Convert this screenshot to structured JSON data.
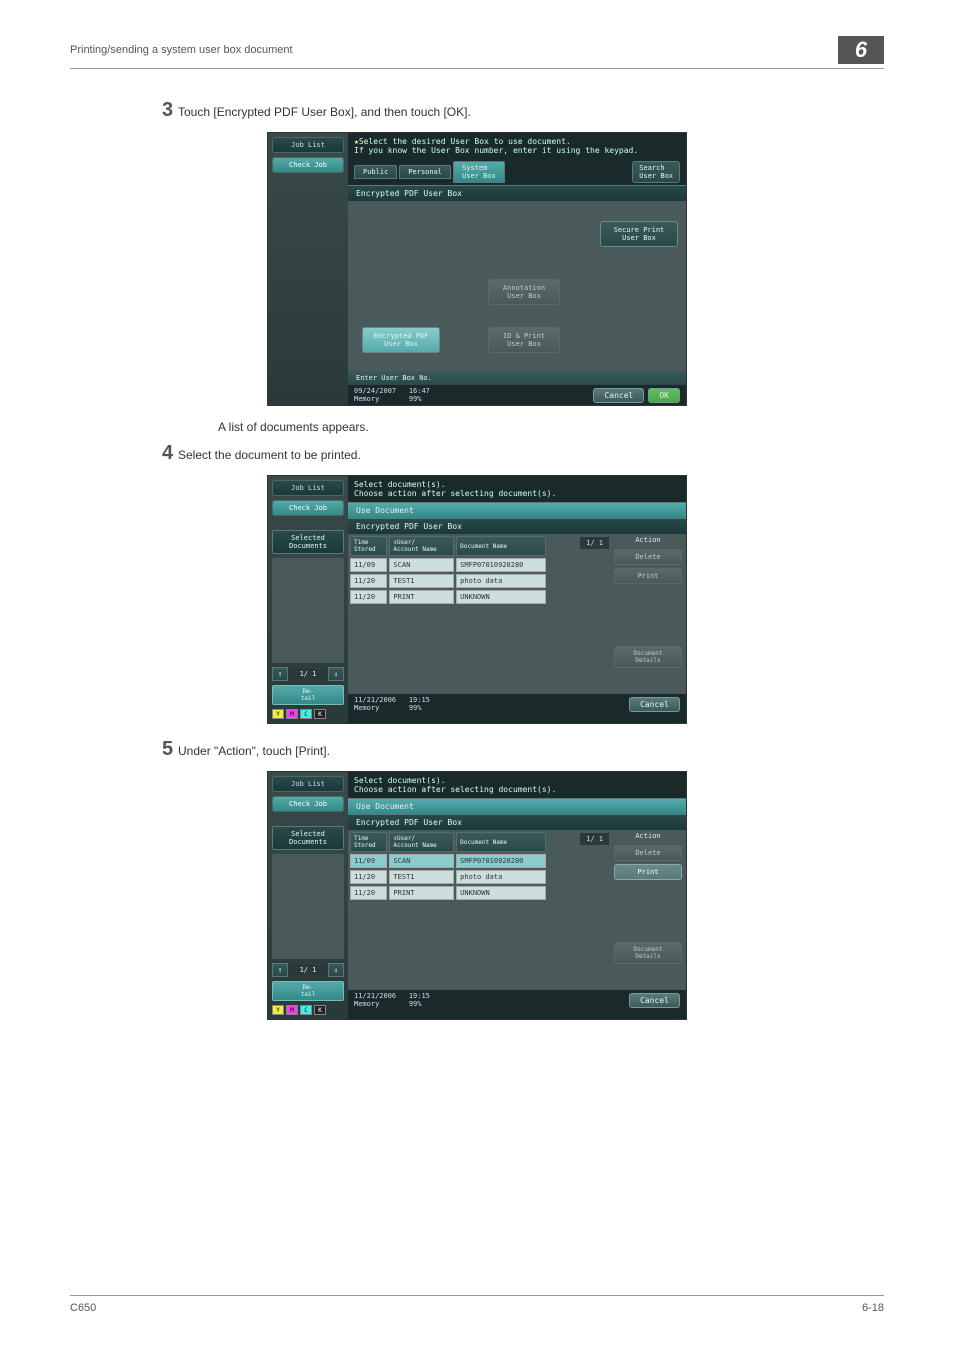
{
  "header": {
    "title": "Printing/sending a system user box document",
    "chapnum": "6"
  },
  "footer": {
    "left": "C650",
    "right": "6-18"
  },
  "step3": {
    "num": "3",
    "text": "Touch [Encrypted PDF User Box], and then touch [OK]."
  },
  "intertext": "A list of documents appears.",
  "step4": {
    "num": "4",
    "text": "Select the document to be printed."
  },
  "step5": {
    "num": "5",
    "text": "Under \"Action\", touch [Print]."
  },
  "screen1": {
    "joblist": "Job List",
    "checkjob": "Check Job",
    "prompt1": "Select the desired User Box to use document.",
    "prompt2": "If you know the User Box number, enter it using the keypad.",
    "tab_public": "Public",
    "tab_personal": "Personal",
    "tab_system": "System\nUser Box",
    "search": "Search\nUser Box",
    "subheader": "Encrypted PDF User Box",
    "secure": "Secure Print\nUser Box",
    "annotation": "Annotation\nUser Box",
    "encrypted": "Encrypted PDF\nUser Box",
    "idprint": "ID & Print\nUser Box",
    "enterbox": "Enter User Box No.",
    "date": "09/24/2007",
    "time": "16:47",
    "memory": "Memory",
    "mempct": "99%",
    "cancel": "Cancel",
    "ok": "OK"
  },
  "screen2": {
    "prompt1": "Select document(s).",
    "prompt2": "Choose action after selecting document(s).",
    "usedoc": "Use Document",
    "subheader": "Encrypted PDF User Box",
    "seldocs": "Selected Documents",
    "col_time": "Time\nStored",
    "col_user": "User/\nAccount Name",
    "col_doc": "Document Name",
    "rows": [
      {
        "time": "11/09",
        "user": "SCAN",
        "doc": "SMFP07010920280"
      },
      {
        "time": "11/20",
        "user": "TEST1",
        "doc": "photo data"
      },
      {
        "time": "11/20",
        "user": "PRINT",
        "doc": "UNKNOWN"
      }
    ],
    "pageind": "1/  1",
    "action": "Action",
    "delete": "Delete",
    "print": "Print",
    "docdetails": "Document\nDetails",
    "pager": "1/  1",
    "detail": "De-\ntail",
    "date": "11/21/2006",
    "time": "19:15",
    "memory": "Memory",
    "mempct": "99%",
    "cancel": "Cancel"
  }
}
